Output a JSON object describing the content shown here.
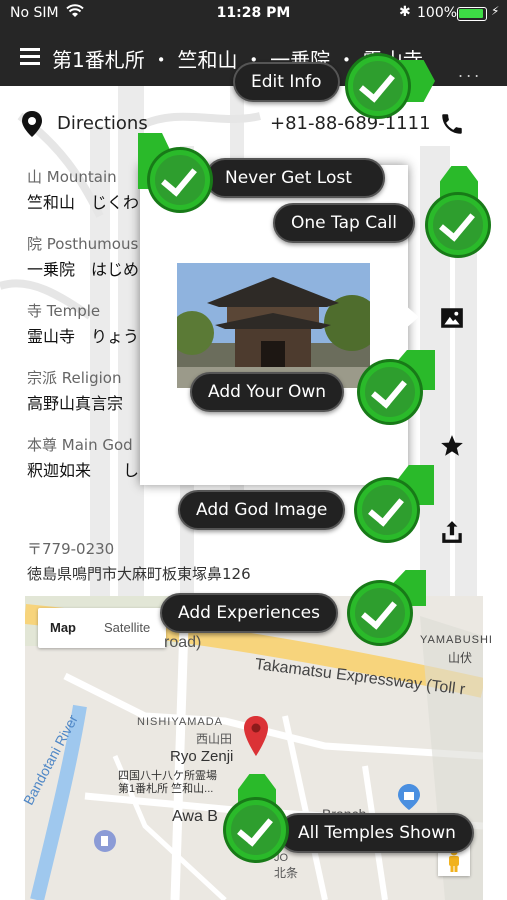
{
  "status_bar": {
    "carrier": "No SIM",
    "time": "11:28 PM",
    "battery": "100%"
  },
  "nav": {
    "title": "第1番札所 ・ 竺和山 ・ 一乗院 ・ 霊山寺",
    "more": "..."
  },
  "contact": {
    "directions_label": "Directions",
    "phone": "+81-88-689-1111"
  },
  "info": [
    {
      "label": "山 Mountain",
      "value": "竺和山　じくわ"
    },
    {
      "label": "院 Posthumous",
      "value": "一乗院　はじめ"
    },
    {
      "label": "寺 Temple",
      "value": "霊山寺　りょう"
    },
    {
      "label": "宗派 Religion",
      "value": "高野山真言宗"
    },
    {
      "label": "本尊 Main God",
      "value": "釈迦如来　　し"
    }
  ],
  "address": {
    "postal": "〒779-0230",
    "line": "徳島県鳴門市大麻町板東塚鼻126"
  },
  "map": {
    "toggle": [
      "Map",
      "Satellite"
    ],
    "labels": {
      "road_fragment": "road)",
      "expressway": "Takamatsu Expressway (Toll r",
      "yamabushi": "YAMABUSHI",
      "yamabushi_jp": "山伏",
      "nishiyamada": "NISHIYAMADA",
      "nishiyamada_jp": "西山田",
      "place": "Ryo Zenji",
      "place_jp1": "四国八十八ケ所霊場",
      "place_jp2": "第1番札所 竺和山...",
      "river": "Bandotani River",
      "awa": "Awa B",
      "branch": "Branch",
      "jo": "JO",
      "hojo": "北条"
    }
  },
  "callouts": {
    "edit_info": "Edit Info",
    "never_lost": "Never Get Lost",
    "one_tap": "One Tap Call",
    "add_own": "Add Your Own",
    "god_image": "Add God Image",
    "experiences": "Add Experiences",
    "all_temples": "All Temples Shown"
  },
  "colors": {
    "accent_green": "#2aba2a",
    "bar": "#262626",
    "pin_red": "#db3236"
  }
}
